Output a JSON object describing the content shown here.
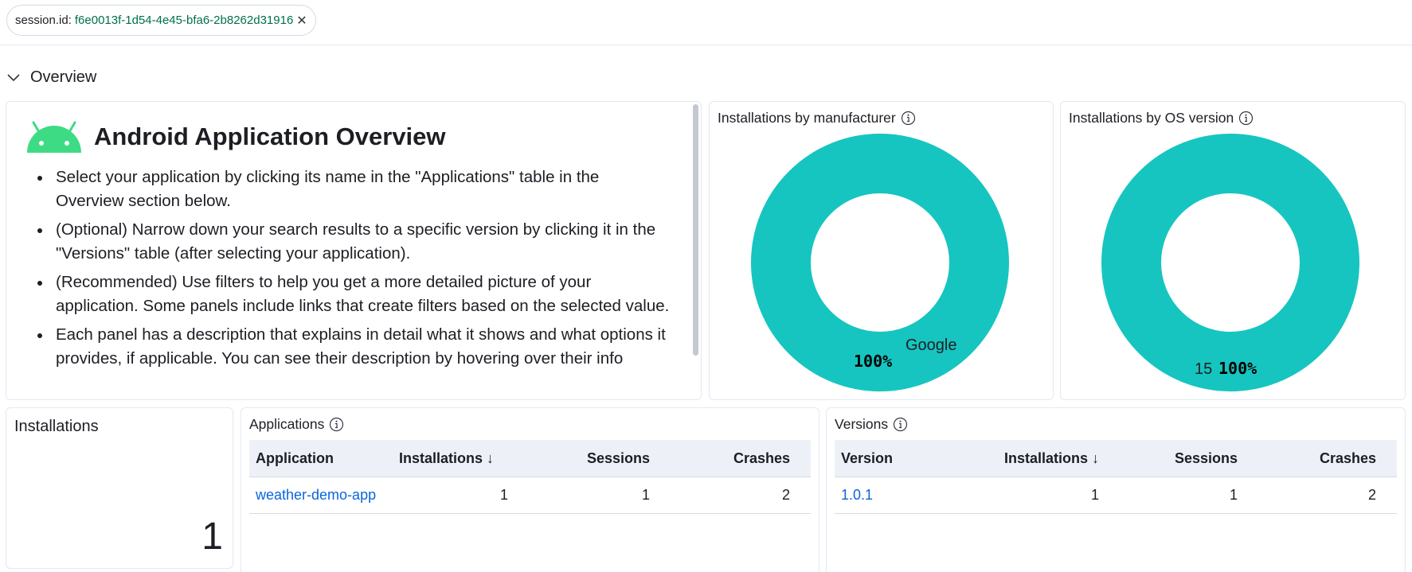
{
  "filter": {
    "key": "session.id:",
    "value": "f6e0013f-1d54-4e45-bfa6-2b8262d31916",
    "remove_glyph": "✕"
  },
  "section": {
    "title": "Overview",
    "chevron_icon": "chevron-down-icon"
  },
  "overview_md": {
    "logo_icon": "android-logo-icon",
    "logo_color": "#3ddc84",
    "title": "Android Application Overview",
    "bullets": [
      "Select your application by clicking its name in the \"Applications\" table in the Overview section below.",
      "(Optional) Narrow down your search results to a specific version by clicking it in the \"Versions\" table (after selecting your application).",
      "(Recommended) Use filters to help you get a more detailed picture of your application. Some panels include links that create filters based on the selected value.",
      "Each panel has a description that explains in detail what it shows and what options it provides, if applicable. You can see their description by hovering over their info"
    ]
  },
  "donut_color": "#16c5c0",
  "manufacturer_panel": {
    "title": "Installations by manufacturer",
    "slice_label": "Google",
    "percent_label": "100%"
  },
  "os_panel": {
    "title": "Installations by OS version",
    "slice_label": "15",
    "percent_label": "100%"
  },
  "chart_data": [
    {
      "type": "pie",
      "title": "Installations by manufacturer",
      "categories": [
        "Google"
      ],
      "values": [
        100
      ]
    },
    {
      "type": "pie",
      "title": "Installations by OS version",
      "categories": [
        "15"
      ],
      "values": [
        100
      ]
    }
  ],
  "installations_metric": {
    "title": "Installations",
    "value": "1"
  },
  "applications_table": {
    "title": "Applications",
    "headers": [
      "Application",
      "Installations ↓",
      "Sessions",
      "Crashes"
    ],
    "rows": [
      [
        "weather-demo-app",
        "1",
        "1",
        "2"
      ]
    ]
  },
  "versions_table": {
    "title": "Versions",
    "headers": [
      "Version",
      "Installations ↓",
      "Sessions",
      "Crashes"
    ],
    "rows": [
      [
        "1.0.1",
        "1",
        "1",
        "2"
      ]
    ]
  },
  "link_color": "#0b64dd"
}
